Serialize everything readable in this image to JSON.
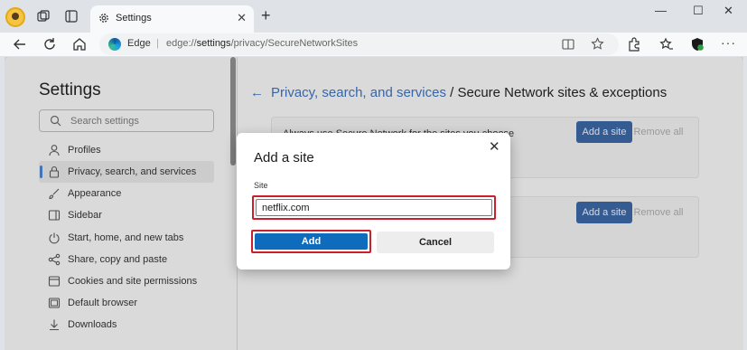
{
  "browser": {
    "tab_title": "Settings",
    "tab_close": "✕",
    "new_tab": "+",
    "window_controls": {
      "minimize": "—",
      "maximize": "☐",
      "close": "✕"
    },
    "address": {
      "site_label": "Edge",
      "separator": "|",
      "url_scheme": "edge://",
      "url_bold": "settings",
      "url_rest": "/privacy/SecureNetworkSites"
    }
  },
  "sidebar": {
    "title": "Settings",
    "search_placeholder": "Search settings",
    "items": [
      {
        "label": "Profiles",
        "icon": "person-icon"
      },
      {
        "label": "Privacy, search, and services",
        "icon": "lock-icon"
      },
      {
        "label": "Appearance",
        "icon": "brush-icon"
      },
      {
        "label": "Sidebar",
        "icon": "sidebar-icon"
      },
      {
        "label": "Start, home, and new tabs",
        "icon": "power-icon"
      },
      {
        "label": "Share, copy and paste",
        "icon": "share-icon"
      },
      {
        "label": "Cookies and site permissions",
        "icon": "cookie-icon"
      },
      {
        "label": "Default browser",
        "icon": "browser-icon"
      },
      {
        "label": "Downloads",
        "icon": "download-icon"
      }
    ]
  },
  "main": {
    "back_arrow": "←",
    "breadcrumb_link": "Privacy, search, and services",
    "breadcrumb_rest": "/ Secure Network sites & exceptions",
    "card1_text": "Always use Secure Network for the sites you choose",
    "add_site_label": "Add a site",
    "remove_all_label": "Remove all"
  },
  "dialog": {
    "title": "Add a site",
    "close": "✕",
    "field_label": "Site",
    "field_value": "netflix.com",
    "add_label": "Add",
    "cancel_label": "Cancel"
  },
  "colors": {
    "accent": "#0f6cbd",
    "highlight": "#c9202e"
  }
}
